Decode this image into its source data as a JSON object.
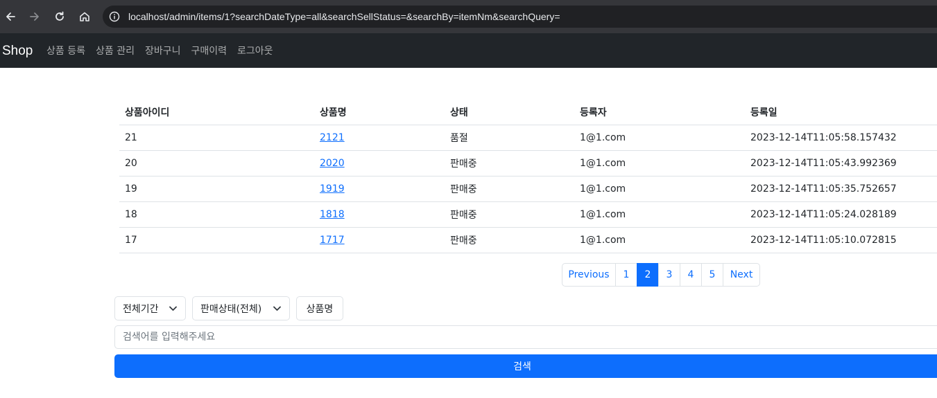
{
  "browser": {
    "url": "localhost/admin/items/1?searchDateType=all&searchSellStatus=&searchBy=itemNm&searchQuery="
  },
  "navbar": {
    "brand": "Shop",
    "links": [
      "상품 등록",
      "상품 관리",
      "장바구니",
      "구매이력",
      "로그아웃"
    ]
  },
  "table": {
    "headers": [
      "상품아이디",
      "상품명",
      "상태",
      "등록자",
      "등록일"
    ],
    "rows": [
      {
        "id": "21",
        "name": "2121",
        "status": "품절",
        "registrant": "1@1.com",
        "date": "2023-12-14T11:05:58.157432"
      },
      {
        "id": "20",
        "name": "2020",
        "status": "판매중",
        "registrant": "1@1.com",
        "date": "2023-12-14T11:05:43.992369"
      },
      {
        "id": "19",
        "name": "1919",
        "status": "판매중",
        "registrant": "1@1.com",
        "date": "2023-12-14T11:05:35.752657"
      },
      {
        "id": "18",
        "name": "1818",
        "status": "판매중",
        "registrant": "1@1.com",
        "date": "2023-12-14T11:05:24.028189"
      },
      {
        "id": "17",
        "name": "1717",
        "status": "판매중",
        "registrant": "1@1.com",
        "date": "2023-12-14T11:05:10.072815"
      }
    ]
  },
  "pagination": {
    "previous": "Previous",
    "pages": [
      "1",
      "2",
      "3",
      "4",
      "5"
    ],
    "active_page": "2",
    "next": "Next"
  },
  "search": {
    "date_type": "전체기간",
    "sell_status": "판매상태(전체)",
    "search_by": "상품명",
    "query_placeholder": "검색어를 입력해주세요",
    "query_value": "",
    "submit": "검색"
  },
  "colors": {
    "navbar_bg": "#212529",
    "primary": "#0d6efd"
  }
}
